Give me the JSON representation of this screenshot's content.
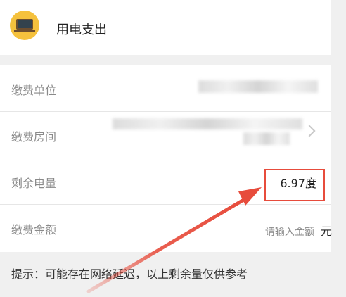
{
  "header": {
    "title": "用电支出"
  },
  "rows": [
    {
      "label": "缴费单位",
      "value": ""
    },
    {
      "label": "缴费房间",
      "value": ""
    },
    {
      "label": "剩余电量",
      "value": "6.97度"
    },
    {
      "label": "缴费金额",
      "placeholder": "请输入金额",
      "unit": "元"
    }
  ],
  "tip": {
    "text": "提示：可能存在网络延迟，以上剩余量仅供参考"
  },
  "colors": {
    "page_bg": "#f0f0f0",
    "card_bg": "#ffffff",
    "label": "#8a8a8a",
    "value": "#222222",
    "divider": "#e6e6e6",
    "annotation": "#e74c3c",
    "avatar_bg": "#f5c13d"
  },
  "icons": {
    "header_avatar": "blackboard-icon",
    "row_2_right": "chevron-right-icon"
  }
}
